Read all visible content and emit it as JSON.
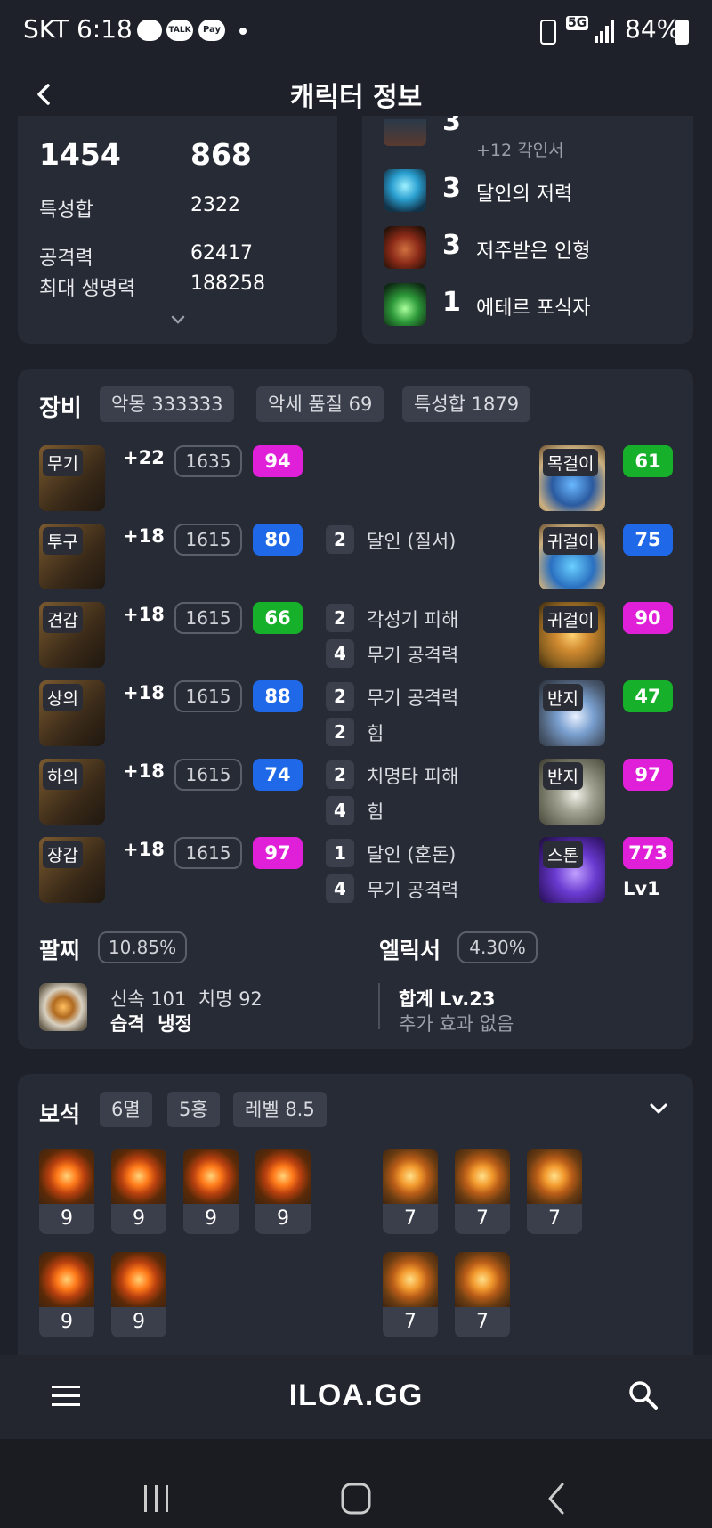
{
  "status_bar": {
    "carrier_time": "SKT 6:18",
    "battery": "84%",
    "network": "5G"
  },
  "header": {
    "title": "캐릭터 정보"
  },
  "stats": {
    "top_left": "1454",
    "top_right": "868",
    "rows": [
      {
        "label": "특성합",
        "value": "2322"
      },
      {
        "label": "공격력",
        "value": "62417"
      },
      {
        "label": "최대 생명력",
        "value": "188258"
      }
    ]
  },
  "engravings": [
    {
      "level": "3",
      "name": "+12 각인서"
    },
    {
      "level": "3",
      "name": "달인의 저력"
    },
    {
      "level": "3",
      "name": "저주받은 인형"
    },
    {
      "level": "1",
      "name": "에테르 포식자"
    }
  ],
  "equipment": {
    "title": "장비",
    "chips": [
      "악몽 333333",
      "악세 품질 69",
      "특성합 1879"
    ],
    "items": [
      {
        "tag": "무기",
        "upgrade": "+22",
        "ilvl": "1635",
        "quality": "94",
        "qcolor": "#e020d8",
        "effects": []
      },
      {
        "tag": "투구",
        "upgrade": "+18",
        "ilvl": "1615",
        "quality": "80",
        "qcolor": "#1f68e8",
        "effects": [
          {
            "n": "2",
            "t": "달인 (질서)"
          }
        ]
      },
      {
        "tag": "견갑",
        "upgrade": "+18",
        "ilvl": "1615",
        "quality": "66",
        "qcolor": "#17b02a",
        "effects": [
          {
            "n": "2",
            "t": "각성기 피해"
          },
          {
            "n": "4",
            "t": "무기 공격력"
          }
        ]
      },
      {
        "tag": "상의",
        "upgrade": "+18",
        "ilvl": "1615",
        "quality": "88",
        "qcolor": "#1f68e8",
        "effects": [
          {
            "n": "2",
            "t": "무기 공격력"
          },
          {
            "n": "2",
            "t": "힘"
          }
        ]
      },
      {
        "tag": "하의",
        "upgrade": "+18",
        "ilvl": "1615",
        "quality": "74",
        "qcolor": "#1f68e8",
        "effects": [
          {
            "n": "2",
            "t": "치명타 피해"
          },
          {
            "n": "4",
            "t": "힘"
          }
        ]
      },
      {
        "tag": "장갑",
        "upgrade": "+18",
        "ilvl": "1615",
        "quality": "97",
        "qcolor": "#e020d8",
        "effects": [
          {
            "n": "1",
            "t": "달인 (혼돈)"
          },
          {
            "n": "4",
            "t": "무기 공격력"
          }
        ]
      }
    ],
    "accessories": [
      {
        "tag": "목걸이",
        "quality": "61",
        "qcolor": "#17b02a"
      },
      {
        "tag": "귀걸이",
        "quality": "75",
        "qcolor": "#1f68e8"
      },
      {
        "tag": "귀걸이",
        "quality": "90",
        "qcolor": "#e020d8"
      },
      {
        "tag": "반지",
        "quality": "47",
        "qcolor": "#17b02a"
      },
      {
        "tag": "반지",
        "quality": "97",
        "qcolor": "#e020d8"
      },
      {
        "tag": "스톤",
        "quality": "773",
        "qcolor": "#e020d8",
        "extra": "Lv1"
      }
    ],
    "bracelet": {
      "title": "팔찌",
      "percent": "10.85%",
      "line1": "신속 101  치명 92",
      "line2": "습격  냉정"
    },
    "elixir": {
      "title": "엘릭서",
      "percent": "4.30%",
      "line1": "합계 Lv.23",
      "line2": "추가 효과 없음"
    }
  },
  "gems": {
    "title": "보석",
    "chips": [
      "6멸",
      "5홍",
      "레벨 8.5"
    ],
    "red": [
      "9",
      "9",
      "9",
      "9",
      "9",
      "9"
    ],
    "orange": [
      "7",
      "7",
      "7",
      "7",
      "7"
    ]
  },
  "bottom_nav": {
    "logo": "ILOA.GG"
  }
}
